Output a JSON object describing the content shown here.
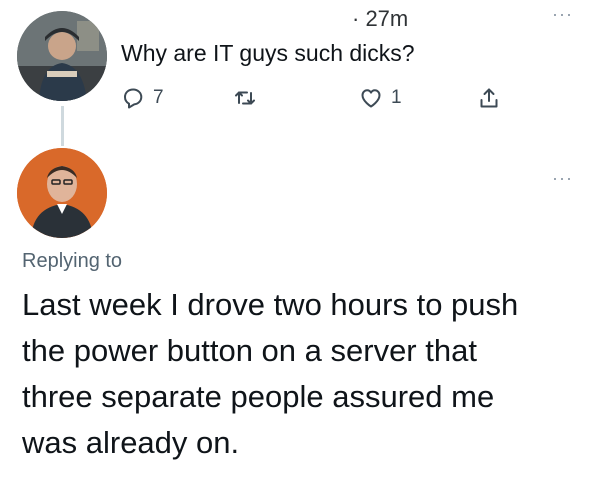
{
  "tweet1": {
    "time": "· 27m",
    "more": "···",
    "text": "Why are IT guys such dicks?",
    "actions": {
      "reply": {
        "icon": "reply-icon",
        "count": "7"
      },
      "retweet": {
        "icon": "retweet-icon",
        "count": ""
      },
      "like": {
        "icon": "heart-icon",
        "count": "1"
      },
      "share": {
        "icon": "share-icon",
        "count": ""
      }
    }
  },
  "tweet2": {
    "more": "···",
    "replying_to": "Replying to",
    "text_lines": [
      "Last week I drove two hours to push",
      "the power button on a server that",
      "three separate people assured me",
      "was already on."
    ]
  },
  "colors": {
    "text": "#0f1419",
    "secondary": "#536471",
    "thread_line": "#cfd9de",
    "avatar2_bg": "#d9692a"
  }
}
